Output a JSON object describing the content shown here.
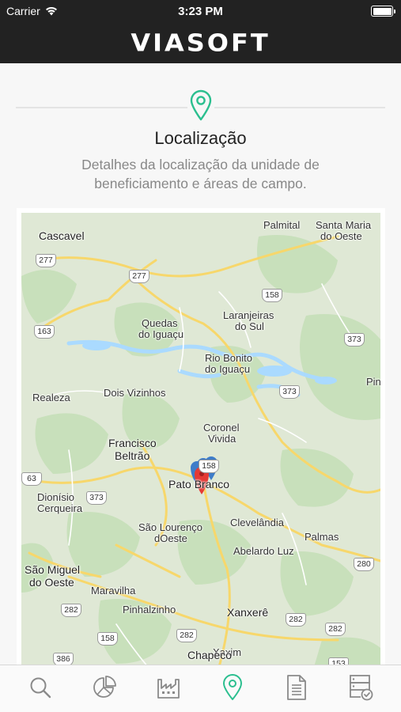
{
  "status_bar": {
    "carrier": "Carrier",
    "time": "3:23 PM"
  },
  "header": {
    "logo_text": "VIASOFT"
  },
  "section": {
    "title": "Localização",
    "description": "Detalhes da localização da unidade de beneficiamento e áreas de campo."
  },
  "map": {
    "cities": {
      "cascavel": "Cascavel",
      "palmital": "Palmital",
      "santa_maria_line1": "Santa Maria",
      "santa_maria_line2": "do Oeste",
      "quedas_line1": "Quedas",
      "quedas_line2": "do Iguaçu",
      "laranjeiras_line1": "Laranjeiras",
      "laranjeiras_line2": "do Sul",
      "rio_bonito_line1": "Rio Bonito",
      "rio_bonito_line2": "do Iguaçu",
      "realeza": "Realeza",
      "dois_vizinhos": "Dois Vizinhos",
      "pin": "Pin",
      "coronel_line1": "Coronel",
      "coronel_line2": "Vivida",
      "francisco_line1": "Francisco",
      "francisco_line2": "Beltrão",
      "pato_branco": "Pato Branco",
      "dionisio_line1": "Dionísio",
      "dionisio_line2": "Cerqueira",
      "sao_lourenco_line1": "São Lourenço",
      "sao_lourenco_line2": "dOeste",
      "clevelandia": "Clevelândia",
      "palmas": "Palmas",
      "abelardo": "Abelardo Luz",
      "sao_miguel_line1": "São Miguel",
      "sao_miguel_line2": "do Oeste",
      "maravilha": "Maravilha",
      "pinhalzinho": "Pinhalzinho",
      "xanxere": "Xanxerê",
      "xaxim": "Xaxim",
      "chapeco": "Chapecó"
    },
    "roads": {
      "r277a": "277",
      "r277b": "277",
      "r158a": "158",
      "r163": "163",
      "r373a": "373",
      "r373b": "373",
      "r373c": "373",
      "r158b": "158",
      "r163b": "63",
      "r280": "280",
      "r282a": "282",
      "r158c": "158",
      "r282b": "282",
      "r282c": "282",
      "r282d": "282",
      "r386": "386",
      "r153": "153"
    },
    "colors": {
      "land": "#dfe8d5",
      "forest": "#c8e0bb",
      "water": "#aadaff",
      "road_yellow": "#f7d76b",
      "marker_red": "#e53935",
      "marker_blue": "#3d7cc9"
    }
  },
  "accent_color": "#2bbf8f",
  "tabs": [
    {
      "icon": "search-icon"
    },
    {
      "icon": "pie-chart-icon"
    },
    {
      "icon": "factory-icon"
    },
    {
      "icon": "location-pin-icon"
    },
    {
      "icon": "document-icon"
    },
    {
      "icon": "server-check-icon"
    }
  ]
}
